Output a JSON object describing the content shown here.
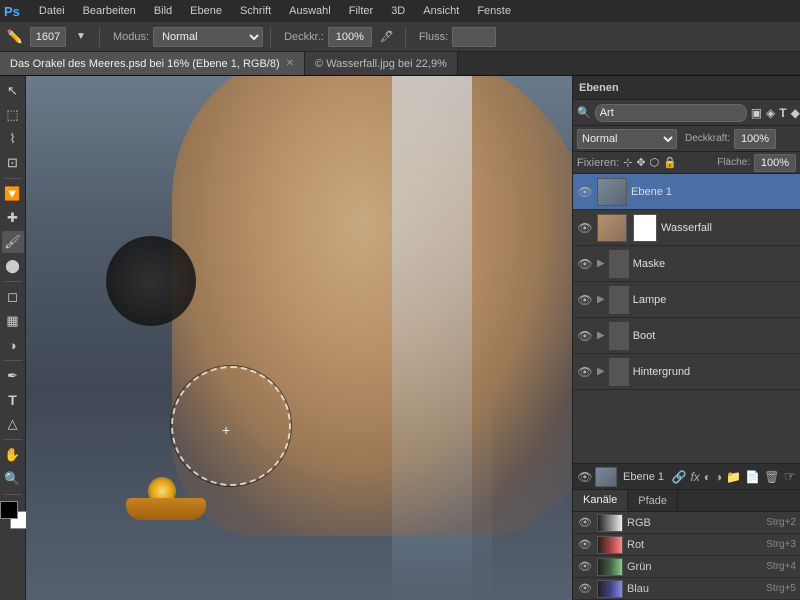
{
  "app": {
    "logo": "Ps",
    "menu_items": [
      "Datei",
      "Bearbeiten",
      "Bild",
      "Ebene",
      "Schrift",
      "Auswahl",
      "Filter",
      "3D",
      "Ansicht",
      "Fenste"
    ]
  },
  "toolbar": {
    "brush_size_label": "1607",
    "modus_label": "Modus:",
    "modus_value": "Normal",
    "deckraft_label": "Deckkr.:",
    "deckraft_value": "100%",
    "fluss_label": "Fluss:",
    "fluss_value": ""
  },
  "tabs": [
    {
      "label": "Das Orakel des Meeres.psd bei 16% (Ebene 1, RGB/8)",
      "active": true,
      "closable": true
    },
    {
      "label": "© Wasserfall.jpg bei 22,9%",
      "active": false,
      "closable": false
    }
  ],
  "layers_panel": {
    "title": "Ebenen",
    "search_placeholder": "Art",
    "blend_mode": "Normal",
    "opacity_label": "Deckkraft:",
    "opacity_value": "100%",
    "fix_label": "Fixieren:",
    "flaeche_label": "Fläche:",
    "flaeche_value": "100%",
    "layers": [
      {
        "name": "Ebene 1",
        "type": "layer",
        "visible": true,
        "selected": true,
        "has_mask": false
      },
      {
        "name": "Wasserfall",
        "type": "layer",
        "visible": true,
        "selected": false,
        "has_mask": true
      },
      {
        "name": "Maske",
        "type": "group",
        "visible": true,
        "selected": false,
        "has_mask": false
      },
      {
        "name": "Lampe",
        "type": "group",
        "visible": true,
        "selected": false,
        "has_mask": false
      },
      {
        "name": "Boot",
        "type": "group",
        "visible": true,
        "selected": false,
        "has_mask": false
      },
      {
        "name": "Hintergrund",
        "type": "group",
        "visible": true,
        "selected": false,
        "has_mask": false
      }
    ],
    "footer_layer_name": "Ebene 1"
  },
  "channels_panel": {
    "tabs": [
      "Kanäle",
      "Pfade"
    ],
    "active_tab": "Kanäle",
    "channels": [
      {
        "name": "RGB",
        "shortcut": "Strg+2",
        "visible": true
      },
      {
        "name": "Rot",
        "shortcut": "Strg+3",
        "visible": true
      },
      {
        "name": "Grün",
        "shortcut": "Strg+4",
        "visible": true
      },
      {
        "name": "Blau",
        "shortcut": "Strg+5",
        "visible": true
      }
    ]
  }
}
